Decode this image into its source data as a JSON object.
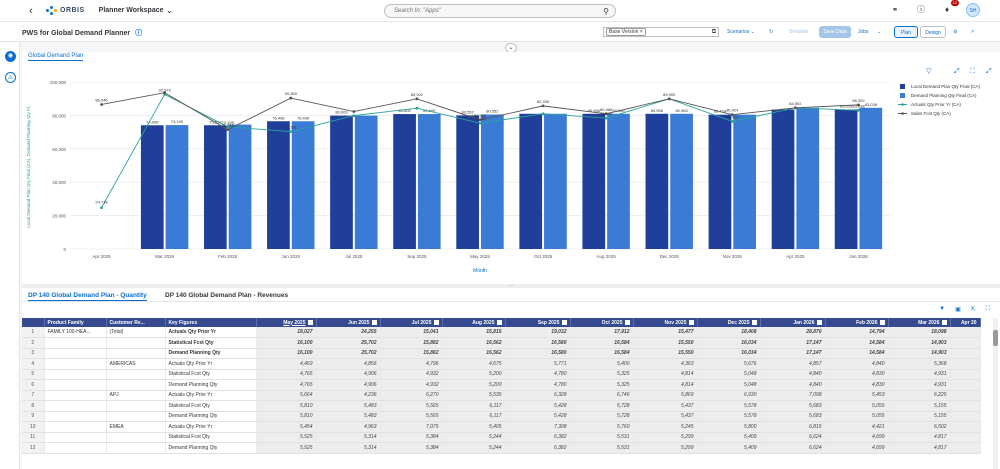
{
  "shell": {
    "app_name": "Planner Workspace",
    "logo_text": "ORBIS",
    "search_placeholder": "Search In: \"Apps\"",
    "notifications": "10",
    "avatar": "SH"
  },
  "toolbar": {
    "title": "PWS for Global Demand Planner",
    "version": "Base Version",
    "scenarios": "Scenarios",
    "simulate": "Simulate",
    "save_data": "Save Data",
    "jobs": "Jobs",
    "plan": "Plan",
    "design": "Design"
  },
  "chart_tab": "Global Demand Plan",
  "chart_data": {
    "type": "bar",
    "categories": [
      "Apr 2025",
      "Mar 2026",
      "Feb 2026",
      "Jun 2025",
      "Jul 2025",
      "Sep 2025",
      "May 2025",
      "Oct 2025",
      "Aug 2025",
      "Dec 2025",
      "Nov 2025",
      "Apr 2025",
      "Jan 2026"
    ],
    "series": [
      {
        "name": "Local Demand Plan Qty Final (CA)",
        "color": "#1f3f9a",
        "values": [
          null,
          74099,
          74099,
          76496,
          79869,
          80800,
          80008,
          80966,
          80966,
          80966,
          80424,
          83532,
          83553
        ]
      },
      {
        "name": "Demand Planning Qty Final (CA)",
        "color": "#3a7bd5",
        "values": [
          null,
          74199,
          74499,
          76496,
          79869,
          80800,
          80552,
          80966,
          80966,
          80966,
          80424,
          84553,
          84553
        ]
      },
      {
        "name": "Actuals Qty Prior Yr (CA)",
        "color": "#2aa39b",
        "values": [
          24718,
          92579,
          73159,
          70281,
          79869,
          84312,
          75337,
          80966,
          78399,
          89902,
          76424,
          84552,
          83038
        ]
      },
      {
        "name": "Sales Fcst Qty (CA)",
        "color": "#555555",
        "values": [
          86546,
          93579,
          71510,
          90369,
          82330,
          89922,
          77332,
          85700,
          80966,
          89900,
          80424,
          84552,
          86302
        ]
      }
    ],
    "point_labels": {
      "line_actuals": [
        "24,718",
        "92,579",
        "73,159",
        "70,281",
        "",
        "",
        "75,337",
        "",
        "78,399",
        "",
        "76,424",
        "84,552",
        "83,038"
      ],
      "line_sales": [
        "86,546",
        "",
        "71,510",
        "90,369",
        "",
        "89,922",
        "80,552",
        "82,330",
        "80,966",
        "89,900",
        "80,424",
        "",
        "86,302"
      ],
      "bar_local": [
        "",
        "74,099",
        "75,519",
        "76,496",
        "80,609",
        "80,800",
        "80,552",
        "",
        "80,966",
        "80,966",
        "80,424",
        "",
        "83,553"
      ],
      "bar_demand": [
        "",
        "74,199",
        "",
        "76,496",
        "",
        "80,609",
        "80,552",
        "",
        "80,966",
        "80,966",
        "",
        "",
        "83,038"
      ]
    },
    "ylabel": "Local Demand Plan Qty Final (CA), Demand Planning Qty Fi...",
    "xlabel": "Month",
    "yticks": [
      "0",
      "20,000",
      "40,000",
      "60,000",
      "80,000",
      "100,000"
    ],
    "ylim": [
      0,
      100000
    ],
    "legend_position": "right"
  },
  "table_tabs": [
    "DP 140 Global Demand Plan - Quantity",
    "DP 140 Global Demand Plan - Revenues"
  ],
  "table": {
    "headers": [
      "Product Family",
      "Customer Re...",
      "Key Figures",
      "May 2025",
      "Jun 2025",
      "Jul 2025",
      "Aug 2025",
      "Sep 2025",
      "Oct 2025",
      "Nov 2025",
      "Dec 2025",
      "Jan 2026",
      "Feb 2026",
      "Mar 2026",
      "Apr 20"
    ],
    "rows": [
      {
        "n": "1",
        "pf": "FAMILY 100-HEA...",
        "cr": "(Total)",
        "kf": "Actuals Qty Prior Yr",
        "v": [
          "18,027",
          "24,255",
          "15,041",
          "15,815",
          "19,032",
          "17,912",
          "15,477",
          "18,408",
          "28,870",
          "14,794",
          "18,098"
        ],
        "bold": true
      },
      {
        "n": "2",
        "pf": "",
        "cr": "",
        "kf": "Statistical Fcst Qty",
        "v": [
          "16,100",
          "25,702",
          "15,882",
          "16,562",
          "16,580",
          "16,584",
          "15,550",
          "16,034",
          "17,147",
          "14,584",
          "14,903"
        ],
        "bold": true
      },
      {
        "n": "3",
        "pf": "",
        "cr": "",
        "kf": "Demand Planning Qty",
        "v": [
          "16,100",
          "25,702",
          "15,882",
          "16,562",
          "16,580",
          "16,584",
          "15,550",
          "16,034",
          "17,147",
          "14,584",
          "14,903"
        ],
        "bold": true
      },
      {
        "n": "4",
        "pf": "",
        "cr": "AMERICAS",
        "kf": "Actuals Qty Prior Yr",
        "v": [
          "4,469",
          "4,856",
          "4,796",
          "4,675",
          "5,771",
          "5,400",
          "4,363",
          "5,676",
          "4,857",
          "4,840",
          "5,368"
        ],
        "bold": false
      },
      {
        "n": "5",
        "pf": "",
        "cr": "",
        "kf": "Statistical Fcst Qty",
        "v": [
          "4,765",
          "4,906",
          "4,932",
          "5,200",
          "4,780",
          "5,325",
          "4,814",
          "5,048",
          "4,840",
          "4,830",
          "4,931"
        ],
        "bold": false
      },
      {
        "n": "6",
        "pf": "",
        "cr": "",
        "kf": "Demand Planning Qty",
        "v": [
          "4,765",
          "4,906",
          "4,932",
          "5,200",
          "4,780",
          "5,325",
          "4,814",
          "5,048",
          "4,840",
          "4,830",
          "4,931"
        ],
        "bold": false
      },
      {
        "n": "7",
        "pf": "",
        "cr": "APJ",
        "kf": "Actuals Qty Prior Yr",
        "v": [
          "5,664",
          "4,236",
          "6,270",
          "5,535",
          "6,328",
          "6,746",
          "5,869",
          "6,930",
          "7,098",
          "5,453",
          "6,225"
        ],
        "bold": false
      },
      {
        "n": "8",
        "pf": "",
        "cr": "",
        "kf": "Statistical Fcst Qty",
        "v": [
          "5,810",
          "5,483",
          "5,565",
          "6,117",
          "5,428",
          "5,728",
          "5,437",
          "5,578",
          "5,683",
          "5,055",
          "5,155"
        ],
        "bold": false
      },
      {
        "n": "9",
        "pf": "",
        "cr": "",
        "kf": "Demand Planning Qty",
        "v": [
          "5,810",
          "5,483",
          "5,565",
          "6,117",
          "5,428",
          "5,728",
          "5,437",
          "5,578",
          "5,683",
          "5,055",
          "5,155"
        ],
        "bold": false
      },
      {
        "n": "10",
        "pf": "",
        "cr": "EMEA",
        "kf": "Actuals Qty Prior Yr",
        "v": [
          "5,454",
          "4,963",
          "7,075",
          "5,405",
          "7,308",
          "5,760",
          "5,245",
          "5,800",
          "6,815",
          "4,421",
          "6,502"
        ],
        "bold": false
      },
      {
        "n": "11",
        "pf": "",
        "cr": "",
        "kf": "Statistical Fcst Qty",
        "v": [
          "5,525",
          "5,314",
          "5,384",
          "5,244",
          "6,382",
          "5,531",
          "5,299",
          "5,409",
          "6,624",
          "4,699",
          "4,817"
        ],
        "bold": false
      },
      {
        "n": "12",
        "pf": "",
        "cr": "",
        "kf": "Demand Planning Qty",
        "v": [
          "5,525",
          "5,314",
          "5,384",
          "5,244",
          "6,382",
          "5,531",
          "5,299",
          "5,409",
          "6,624",
          "4,699",
          "4,817"
        ],
        "bold": false
      }
    ]
  }
}
